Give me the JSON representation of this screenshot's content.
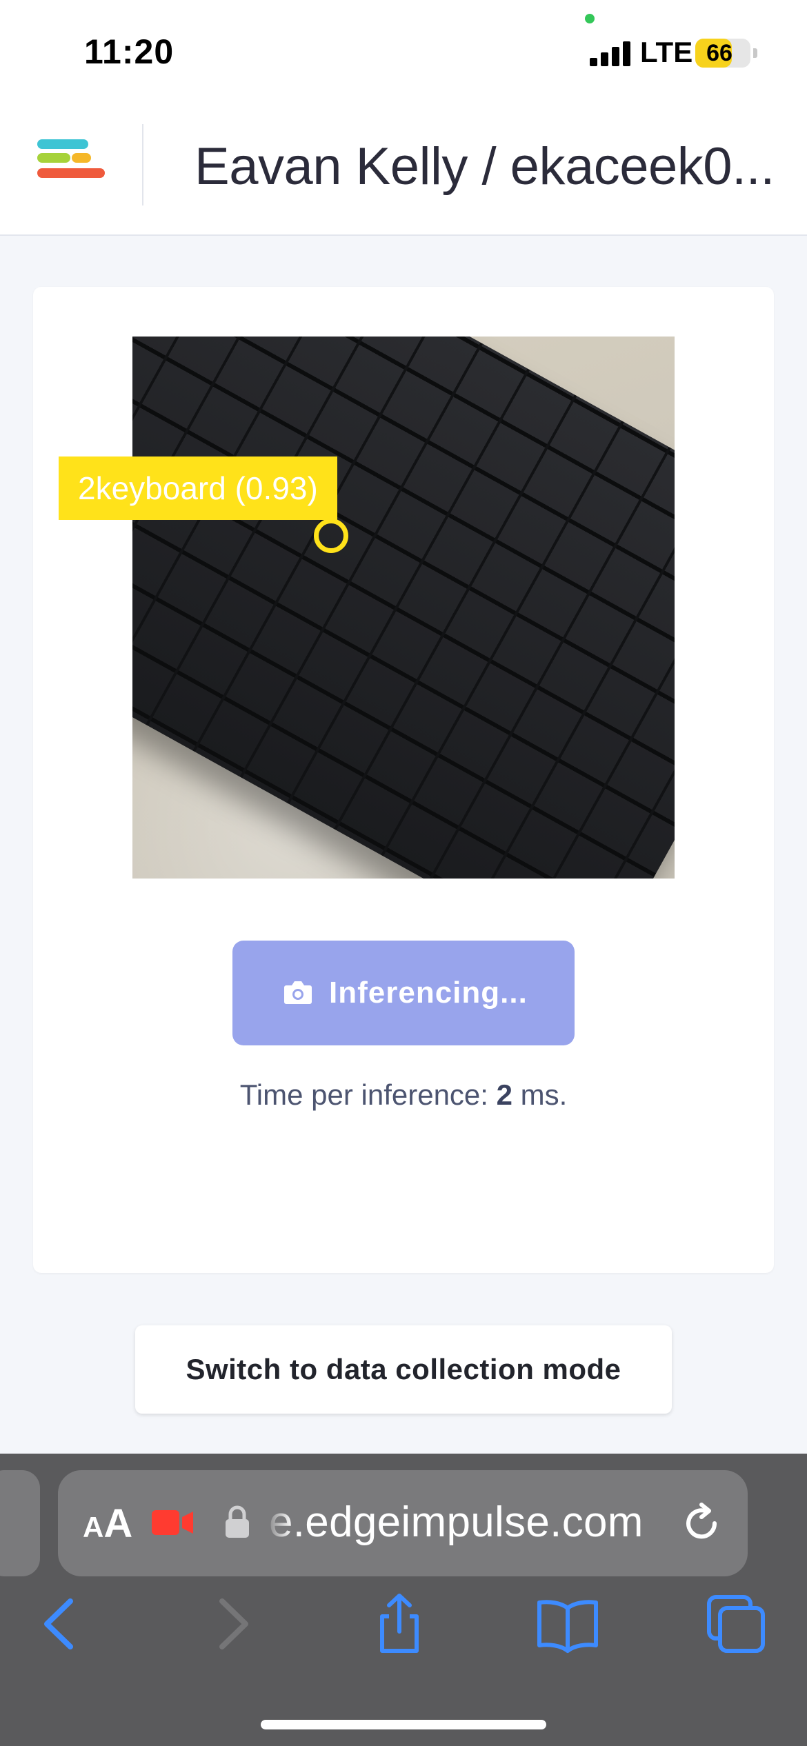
{
  "status_bar": {
    "time": "11:20",
    "network": "LTE",
    "battery_level": "66",
    "battery_fraction": 0.66
  },
  "header": {
    "title": "Eavan Kelly / ekaceek0..."
  },
  "camera": {
    "detection_label": "2keyboard (0.93)"
  },
  "inference": {
    "button_label": "Inferencing...",
    "time_prefix": "Time per inference: ",
    "time_value": "2",
    "time_suffix": " ms."
  },
  "switch_mode": {
    "label": "Switch to data collection mode"
  },
  "browser": {
    "text_size_small": "A",
    "text_size_large": "A",
    "url": "e.edgeimpulse.com"
  },
  "colors": {
    "detection": "#ffe21a",
    "button": "#98a4ec",
    "browser_accent": "#3d8bff",
    "menu_lines": [
      "#3ec4d4",
      "#a6d23a",
      "#f5b729",
      "#ef5a3c"
    ]
  }
}
